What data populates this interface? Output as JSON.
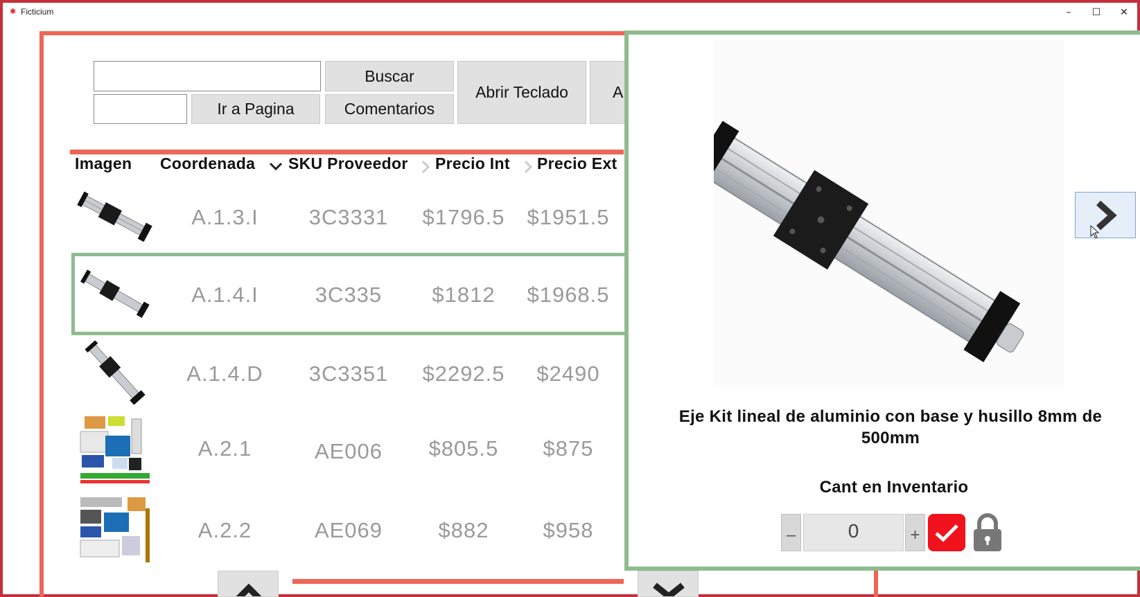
{
  "window": {
    "title": "Ficticium",
    "minimize_glyph": "–",
    "maximize_glyph": "☐",
    "close_glyph": "✕"
  },
  "toolbar": {
    "search_value": "",
    "page_value": "",
    "buscar": "Buscar",
    "ir_a_pagina": "Ir a Pagina",
    "comentarios": "Comentarios",
    "abrir_teclado": "Abrir Teclado",
    "partial_button": "A"
  },
  "table": {
    "columns": [
      "Imagen",
      "Coordenada",
      "SKU Proveedor",
      "Precio Int",
      "Precio Ext"
    ],
    "rows": [
      {
        "coordenada": "A.1.3.I",
        "sku": "3C3331",
        "precio_int": "$1796.5",
        "precio_ext": "$1951.5",
        "image": "linear-rail-kit-thumbnail"
      },
      {
        "coordenada": "A.1.4.I",
        "sku": "3C335",
        "precio_int": "$1812",
        "precio_ext": "$1968.5",
        "image": "linear-rail-kit-thumbnail"
      },
      {
        "coordenada": "A.1.4.D",
        "sku": "3C3351",
        "precio_int": "$2292.5",
        "precio_ext": "$2490",
        "image": "linear-rail-kit-thumbnail"
      },
      {
        "coordenada": "A.2.1",
        "sku": "AE006",
        "precio_int": "$805.5",
        "precio_ext": "$875",
        "image": "arduino-starter-kit-thumbnail"
      },
      {
        "coordenada": "A.2.2",
        "sku": "AE069",
        "precio_int": "$882",
        "precio_ext": "$958",
        "image": "arduino-starter-kit-thumbnail"
      }
    ],
    "selected_row_index": 1
  },
  "detail": {
    "product_name": "Eje Kit lineal de aluminio con base y husillo 8mm de 500mm",
    "inventory_label": "Cant en Inventario",
    "quantity": "0",
    "minus": "–",
    "plus": "+"
  },
  "colors": {
    "window_border": "#c4303a",
    "list_panel_border": "#ee6655",
    "detail_panel_border": "#8fbc8f",
    "confirm_button": "#f0121c",
    "button_gray": "#e1e1e1"
  }
}
